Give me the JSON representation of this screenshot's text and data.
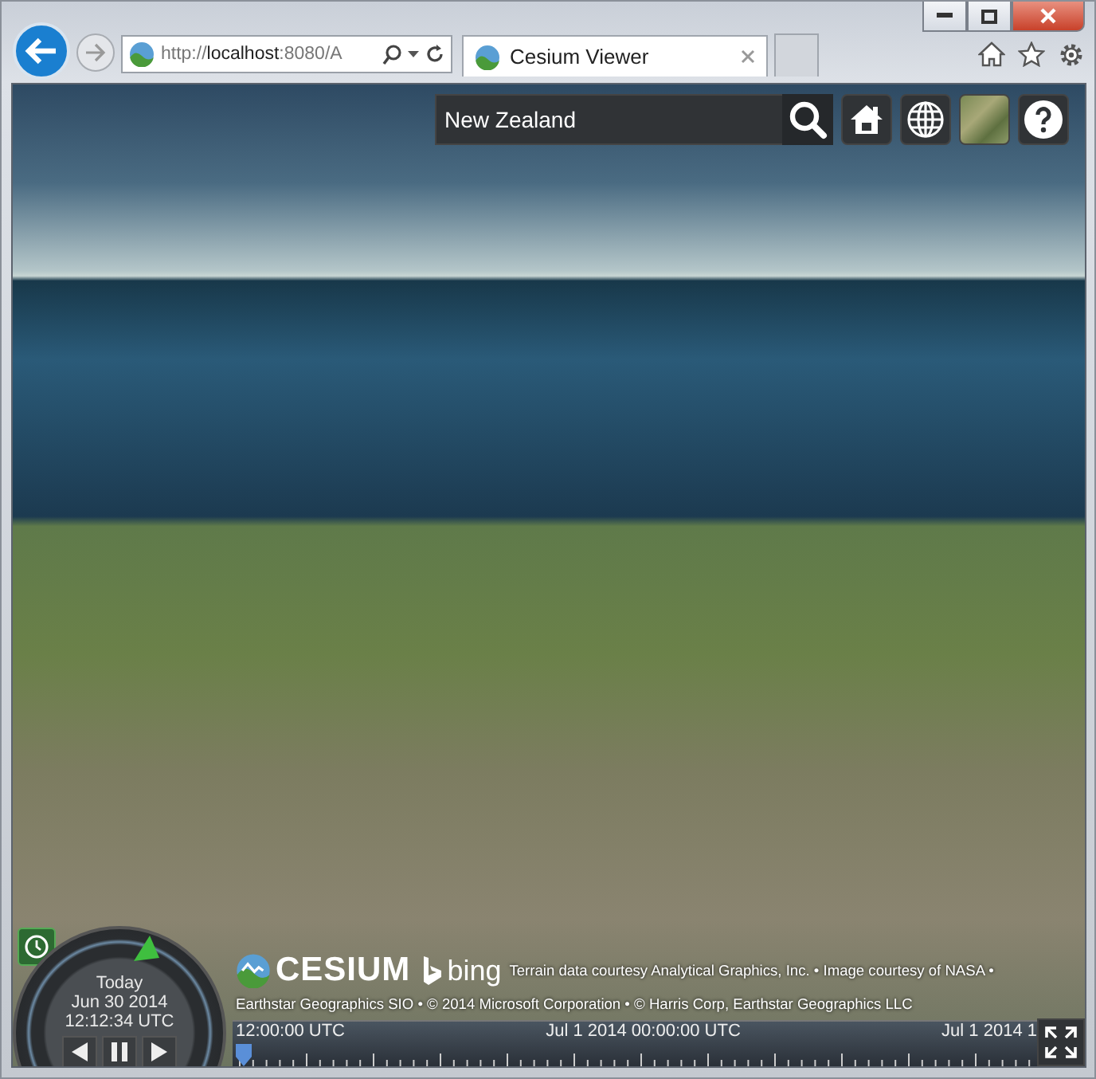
{
  "browser": {
    "address": "http://**localhost**:8080/A",
    "tabs": [
      {
        "label": "Cesium Viewer",
        "selected": true
      }
    ]
  },
  "toolbar": {
    "search": {
      "value": "New Zealand"
    }
  },
  "animation": {
    "day": "Today",
    "date": "Jun 30 2014",
    "time": "12:12:34 UTC"
  },
  "credits": {
    "logos": [
      "CESIUM",
      "bing"
    ],
    "lines": [
      "Terrain data courtesy Analytical Graphics, Inc. • Image courtesy of NASA •",
      "Earthstar Geographics SIO • © 2014 Microsoft Corporation • © Harris Corp, Earthstar Geographics LLC"
    ]
  },
  "timeline": {
    "labels": [
      "12:00:00 UTC",
      "Jul 1 2014 00:00:00 UTC",
      "Jul 1 2014 1"
    ]
  }
}
